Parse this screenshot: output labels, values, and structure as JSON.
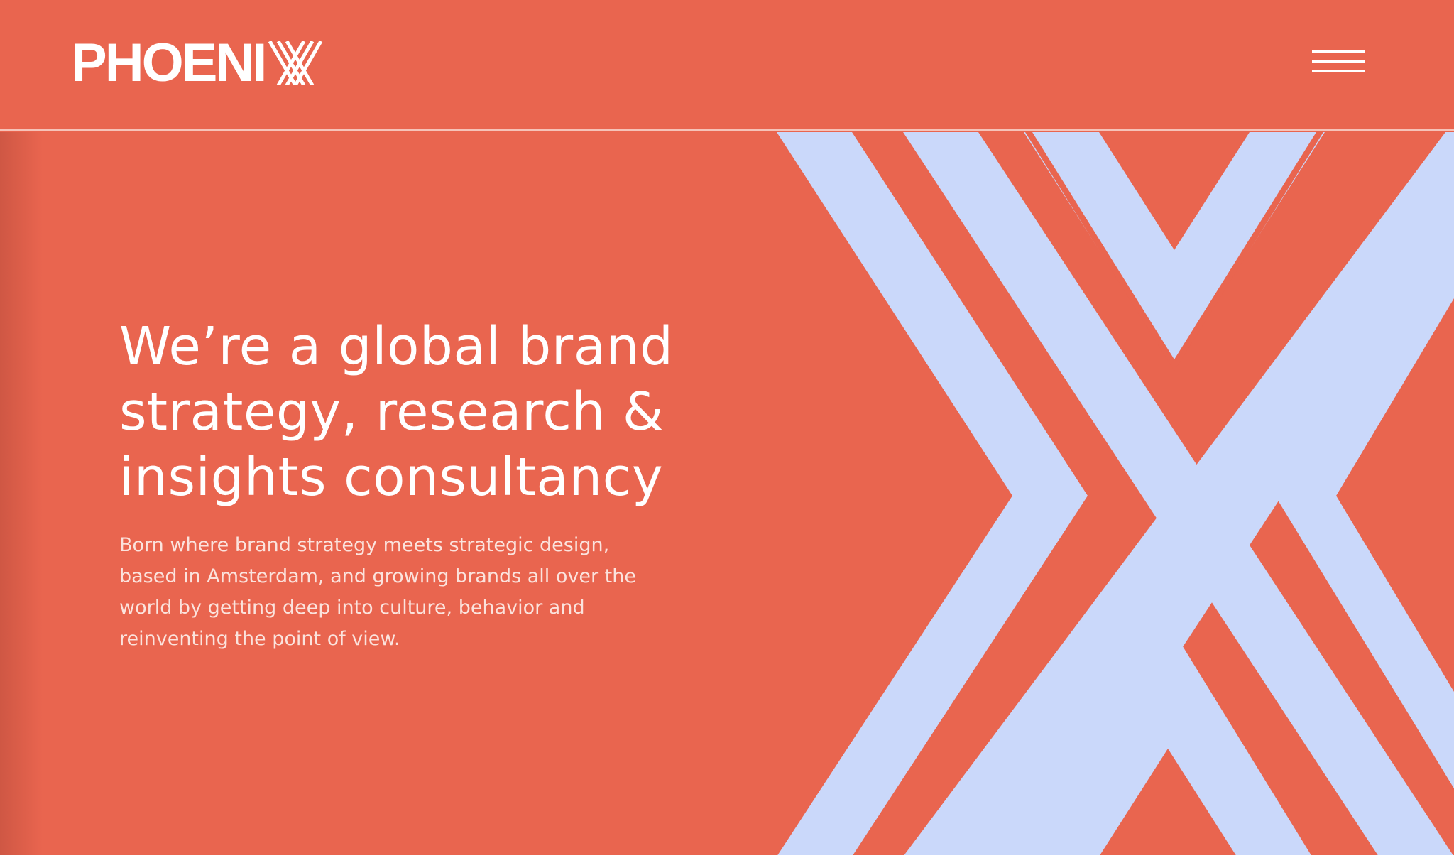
{
  "header": {
    "logo_text": "PHOENI",
    "logo_full": "PHOENIX",
    "menu_icon": "hamburger-menu-icon"
  },
  "hero": {
    "title": "We’re a global brand strategy, research & insights consultancy",
    "description": "Born where brand strategy meets strategic design, based in Amsterdam, and growing brands all over the world by getting deep into culture, behavior and reinventing the point of view.",
    "art_icon": "large-x-chevron-graphic"
  },
  "colors": {
    "brand": "#e9654f",
    "accent": "#cad8fa",
    "text": "#ffffff"
  }
}
